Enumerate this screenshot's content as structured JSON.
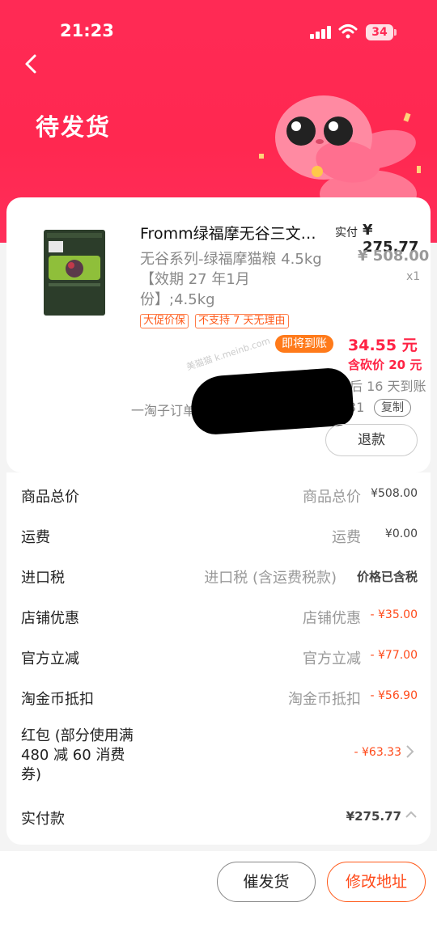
{
  "status_bar": {
    "time": "21:23",
    "battery": "34"
  },
  "header": {
    "title": "待发货"
  },
  "product": {
    "title": "Fromm绿福摩无谷三文…",
    "spec": "无谷系列-绿福摩猫粮 4.5kg【效期 27 年1月份】;4.5kg",
    "paid_label": "实付",
    "paid_amount": "¥ 275.77",
    "original_price": "¥ 508.00",
    "quantity": "x1",
    "tags": [
      "大促价保",
      "不支持 7 天无理由"
    ],
    "arrival_badge": "即将到账",
    "arrival_amount": "34.55 元",
    "cut_price": "含砍价 20 元",
    "days_after": "后 16 天到账",
    "order_prefix": "一淘子订单",
    "order_tail": "31",
    "copy_label": "复制",
    "refund_label": "退款",
    "watermark": "美猫猫 k.meinb.com"
  },
  "fees": [
    {
      "label": "商品总价",
      "desc": "商品总价",
      "value": "¥508.00"
    },
    {
      "label": "运费",
      "desc": "运费",
      "value": "¥0.00"
    },
    {
      "label": "进口税",
      "desc": "进口税 (含运费税款)",
      "value": "价格已含税"
    },
    {
      "label": "店铺优惠",
      "desc": "店铺优惠",
      "value": "- ¥35.00"
    },
    {
      "label": "官方立减",
      "desc": "官方立减",
      "value": "- ¥77.00"
    },
    {
      "label": "淘金币抵扣",
      "desc": "淘金币抵扣",
      "value": "- ¥56.90"
    }
  ],
  "red_packet": {
    "label": "红包 (部分使用满 480 减 60 消费券)",
    "value": "- ¥63.33"
  },
  "total": {
    "label": "实付款",
    "value": "¥275.77"
  },
  "actions": {
    "urge": "催发货",
    "change_address": "修改地址"
  },
  "colors": {
    "accent": "#ff2a55",
    "price_red": "#ff2244",
    "orange": "#ff7a1a"
  }
}
